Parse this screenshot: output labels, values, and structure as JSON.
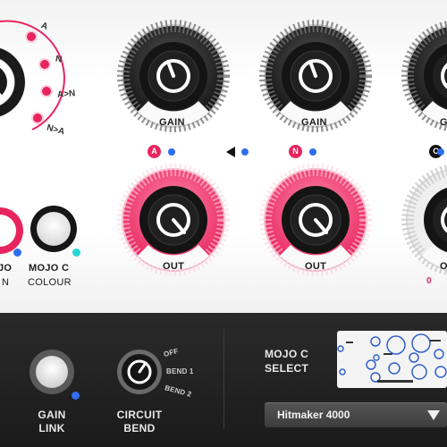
{
  "mode_selector": {
    "options": [
      "A",
      "N",
      "A>N",
      "N>A"
    ]
  },
  "knobs": {
    "gain_a": {
      "label": "GAIN"
    },
    "gain_n": {
      "label": "GAIN"
    },
    "gain_c": {
      "label": "G"
    },
    "out_a": {
      "label": "OUT"
    },
    "out_n": {
      "label": "OUT"
    },
    "out_c": {
      "label": "O"
    }
  },
  "channel_badges": {
    "a": "A",
    "n": "N",
    "c": "C"
  },
  "mojo": {
    "left_label_line1": "JO",
    "left_label_line2": "N",
    "c_label_line1": "MOJO C",
    "c_label_line2": "COLOUR"
  },
  "out_c_value": "0",
  "bottom": {
    "gain_link": {
      "line1": "GAIN",
      "line2": "LINK"
    },
    "circuit_bend": {
      "line1": "CIRCUIT",
      "line2": "BEND",
      "options": [
        "OFF",
        "BEND 1",
        "BEND 2"
      ]
    },
    "mojo_c_select": {
      "line1": "MOJO C",
      "line2": "SELECT",
      "selected": "Hitmaker 4000"
    }
  },
  "colors": {
    "accent_pink": "#e8245e",
    "blue": "#2f6ef0",
    "cyan": "#26d7d7",
    "panel_dark": "#1f1f1f"
  }
}
